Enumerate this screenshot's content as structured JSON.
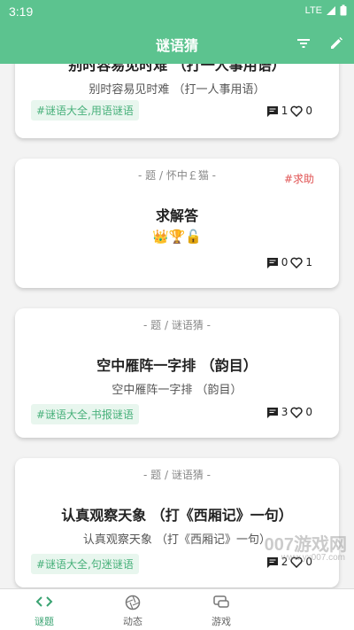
{
  "status_bar": {
    "time": "3:19",
    "network": "LTE"
  },
  "app_bar": {
    "title": "谜语猜"
  },
  "cards": [
    {
      "title": "别时容易见时难 （打一人事用语）",
      "subtitle": "别时容易见时难 （打一人事用语）",
      "tag": "#谜语大全,用语谜语",
      "comments": "1",
      "likes": "0"
    },
    {
      "meta": "- 题 / 怀中￡猫 -",
      "badge": "#求助",
      "title": "求解答",
      "emoji": "👑🏆🔓",
      "comments": "0",
      "likes": "1"
    },
    {
      "meta": "- 题 / 谜语猜 -",
      "title": "空中雁阵一字排 （韵目）",
      "subtitle": "空中雁阵一字排 （韵目）",
      "tag": "#谜语大全,书报谜语",
      "comments": "3",
      "likes": "0"
    },
    {
      "meta": "- 题 / 谜语猜 -",
      "title": "认真观察天象 （打《西厢记》一句）",
      "subtitle": "认真观察天象 （打《西厢记》一句）",
      "tag": "#谜语大全,句迷谜语",
      "comments": "2",
      "likes": "0"
    }
  ],
  "bottom_nav": [
    {
      "label": "谜题",
      "icon": "code-brackets-icon",
      "active": true
    },
    {
      "label": "动态",
      "icon": "aperture-icon",
      "active": false
    },
    {
      "label": "游戏",
      "icon": "gamepad-icon",
      "active": false
    }
  ],
  "watermark": {
    "text": "007游戏网",
    "url_text": "www.yx007.com"
  },
  "colors": {
    "accent": "#5cc38f",
    "tag_text": "#47b07a",
    "tag_bg": "#e8f6ee",
    "badge": "#e05252"
  }
}
